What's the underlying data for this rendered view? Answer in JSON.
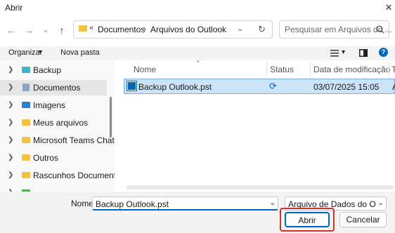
{
  "window": {
    "title": "Abrir",
    "close_glyph": "✕"
  },
  "nav": {
    "back_glyph": "←",
    "forward_glyph": "→",
    "recent_glyph": "⌄",
    "up_glyph": "↑",
    "breadcrumb_overflow": "«",
    "breadcrumb": [
      "Documentos",
      "Arquivos do Outlook"
    ],
    "breadcrumb_sep": "›",
    "refresh_glyph": "↻",
    "search_placeholder": "Pesquisar em Arquivos do ..."
  },
  "toolbar": {
    "organize_label": "Organizar",
    "organize_caret": "▾",
    "new_folder_label": "Nova pasta",
    "view_caret": "▾",
    "help_glyph": "?"
  },
  "tree": [
    {
      "label": "Backup",
      "icon": "folder-teal-icon",
      "color": "#3fb6c7"
    },
    {
      "label": "Documentos",
      "icon": "documents-icon",
      "color": "#8aa4c8",
      "selected": true
    },
    {
      "label": "Imagens",
      "icon": "pictures-icon",
      "color": "#2a7fd4"
    },
    {
      "label": "Meus arquivos",
      "icon": "folder-icon",
      "color": "#f5c243"
    },
    {
      "label": "Microsoft Teams Chat File",
      "icon": "folder-icon",
      "color": "#f5c243"
    },
    {
      "label": "Outros",
      "icon": "folder-icon",
      "color": "#f5c243"
    },
    {
      "label": "Rascunhos Documentaçã",
      "icon": "folder-icon",
      "color": "#f5c243"
    }
  ],
  "columns": {
    "name": "Nome",
    "status": "Status",
    "modified": "Data de modificação",
    "extra": "T"
  },
  "files": [
    {
      "name": "Backup Outlook.pst",
      "status_glyph": "⟳",
      "modified": "03/07/2025 15:05",
      "extra": "A"
    }
  ],
  "footer": {
    "name_label": "Nome:",
    "file_name_value": "Backup Outlook.pst",
    "filter_value": "Arquivo de Dados do Outlook (",
    "dropdown_glyph": "⌄",
    "open_label": "Abrir",
    "cancel_label": "Cancelar"
  },
  "colors": {
    "accent": "#0067c0",
    "highlight": "#d32f2f",
    "selection": "#cce4f7"
  }
}
